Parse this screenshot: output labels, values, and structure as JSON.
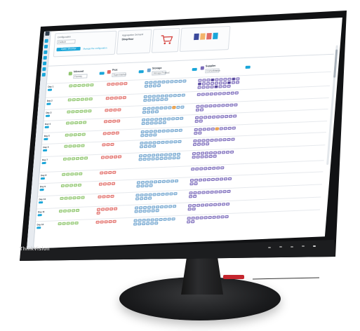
{
  "brand": {
    "chin_logo": "ThinkVision"
  },
  "app": {
    "header_cards": [
      {
        "lines": [
          "Configuration",
          "Default"
        ],
        "button": "Open Shortlist",
        "link": "Manage the configuration"
      },
      {
        "lines": [
          "Aggregation Demand",
          "Shopfloor"
        ]
      },
      {
        "lines": []
      },
      {
        "lines": []
      }
    ],
    "columns": [
      {
        "name": "Inbound",
        "sub": "Factory",
        "color": "#2e8b3d"
      },
      {
        "name": "Pick",
        "sub": "Supermarket",
        "color": "#d33a35"
      },
      {
        "name": "Storage",
        "sub": "Storage Product",
        "color": "#2f7ab8"
      },
      {
        "name": "Supplier",
        "sub": "Consolidation",
        "color": "#5a4aa8"
      }
    ],
    "rows": [
      {
        "label": "Day 1"
      },
      {
        "label": "Day 2"
      },
      {
        "label": "Day 3"
      },
      {
        "label": "Day 4"
      },
      {
        "label": "Day 5"
      },
      {
        "label": "Day 6"
      },
      {
        "label": "Day 7"
      },
      {
        "label": "Day 8"
      },
      {
        "label": "Day 9"
      },
      {
        "label": "Day 10"
      },
      {
        "label": "Day 11"
      },
      {
        "label": "Day 12"
      }
    ]
  }
}
